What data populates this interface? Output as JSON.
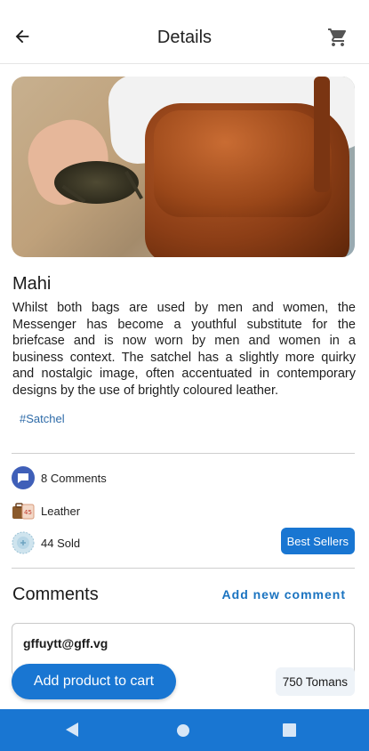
{
  "header": {
    "title": "Details",
    "back_icon": "arrow-left-icon",
    "cart_icon": "shopping-cart-icon"
  },
  "product": {
    "name": "Mahi",
    "description": "Whilst both bags are used by men and women, the Messenger has become a youthful substitute for the briefcase and is now worn by men and women in a business context. The satchel has a slightly more quirky and nostalgic image, often accentuated in contemporary designs by the use of brightly coloured leather.",
    "tag": "#Satchel"
  },
  "meta": {
    "comments": "8 Comments",
    "material": "Leather",
    "sold": "44 Sold",
    "badge": "Best Sellers"
  },
  "comments_section": {
    "title": "Comments",
    "add_link": "Add new comment",
    "items": [
      {
        "user": "gffuytt@gff.vg"
      }
    ]
  },
  "footer": {
    "add_to_cart": "Add product to cart",
    "price": "750 Tomans"
  },
  "colors": {
    "primary": "#1976d2",
    "link": "#1a73c0",
    "divider": "#cfcfcf"
  }
}
